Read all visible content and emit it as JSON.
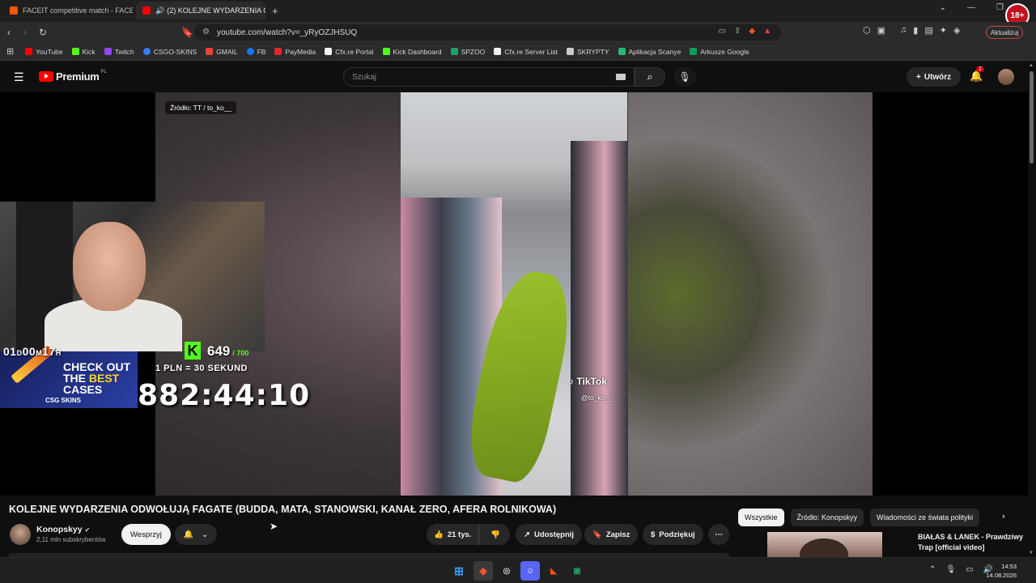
{
  "browser": {
    "tabs": [
      {
        "label": "FACEIT competitive match - FACEIT.c",
        "active": false
      },
      {
        "label": "(2) KOLEJNE WYDARZENIA O",
        "active": true
      }
    ],
    "new_tab": "+",
    "url": "youtube.com/watch?v=_yRyOZJHSUQ",
    "profile_badge": "18+",
    "update_label": "Aktualizuj",
    "bookmarks": [
      {
        "label": "YouTube",
        "color": "#ff0000"
      },
      {
        "label": "Kick",
        "color": "#53fc18"
      },
      {
        "label": "Twitch",
        "color": "#9146ff"
      },
      {
        "label": "CSGO-SKINS",
        "color": "#3d7bff"
      },
      {
        "label": "GMAIL",
        "color": "#ea4335"
      },
      {
        "label": "FB",
        "color": "#1877f2"
      },
      {
        "label": "PayMedia",
        "color": "#e02a2a"
      },
      {
        "label": "Cfx.re Portal",
        "color": "#f2f2f2"
      },
      {
        "label": "Kick Dashboard",
        "color": "#53fc18"
      },
      {
        "label": "SPZOO",
        "color": "#22a06b"
      },
      {
        "label": "Cfx.re Server List",
        "color": "#f2f2f2"
      },
      {
        "label": "SKRYPTY",
        "color": "#cccccc"
      },
      {
        "label": "Aplikacja Scanye",
        "color": "#2bb673"
      },
      {
        "label": "Arkusze Google",
        "color": "#0f9d58"
      }
    ]
  },
  "yt_header": {
    "logo": "Premium",
    "logo_region": "PL",
    "search_placeholder": "Szukaj",
    "create_label": "Utwórz",
    "notif_count": "2"
  },
  "player": {
    "source_label": "Źródło: TT / to_ko__",
    "tiktok_logo": "TikTok",
    "tiktok_handle": "@to_ko__",
    "overlay": {
      "small_timer": {
        "d": "01",
        "du": "D",
        "m": "00",
        "mu": "M",
        "h": "17",
        "hu": "H"
      },
      "kick_count": "649",
      "kick_max": "/ 700",
      "rate": "1 PLN = 30 SEKUND",
      "ad_line1": "CHECK OUT",
      "ad_line2_a": "THE ",
      "ad_line2_b": "BEST",
      "ad_line3": "CASES",
      "ad_brand": "CSG SKINS",
      "big_timer": "882:44:10"
    }
  },
  "video": {
    "title": "KOLEJNE WYDARZENIA ODWOŁUJĄ FAGATE (BUDDA, MATA, STANOWSKI, KANAŁ ZERO, AFERA ROLNIKOWA)",
    "channel": "Konopskyy",
    "subscribers": "2,11 mln subskrybentów",
    "support_label": "Wesprzyj",
    "likes": "21 tys.",
    "share_label": "Udostępnij",
    "save_label": "Zapisz",
    "thanks_label": "Podziękuj"
  },
  "sidebar": {
    "chips": [
      {
        "label": "Wszystkie",
        "active": true
      },
      {
        "label": "Źródło: Konopskyy",
        "active": false
      },
      {
        "label": "Wiadomości ze świata polityki",
        "active": false
      }
    ],
    "recommendation_title": "BIAŁAS & LANEK - Prawdziwy Trap [official video]"
  },
  "taskbar": {
    "time": "14:53",
    "date": "14.08.2026"
  }
}
